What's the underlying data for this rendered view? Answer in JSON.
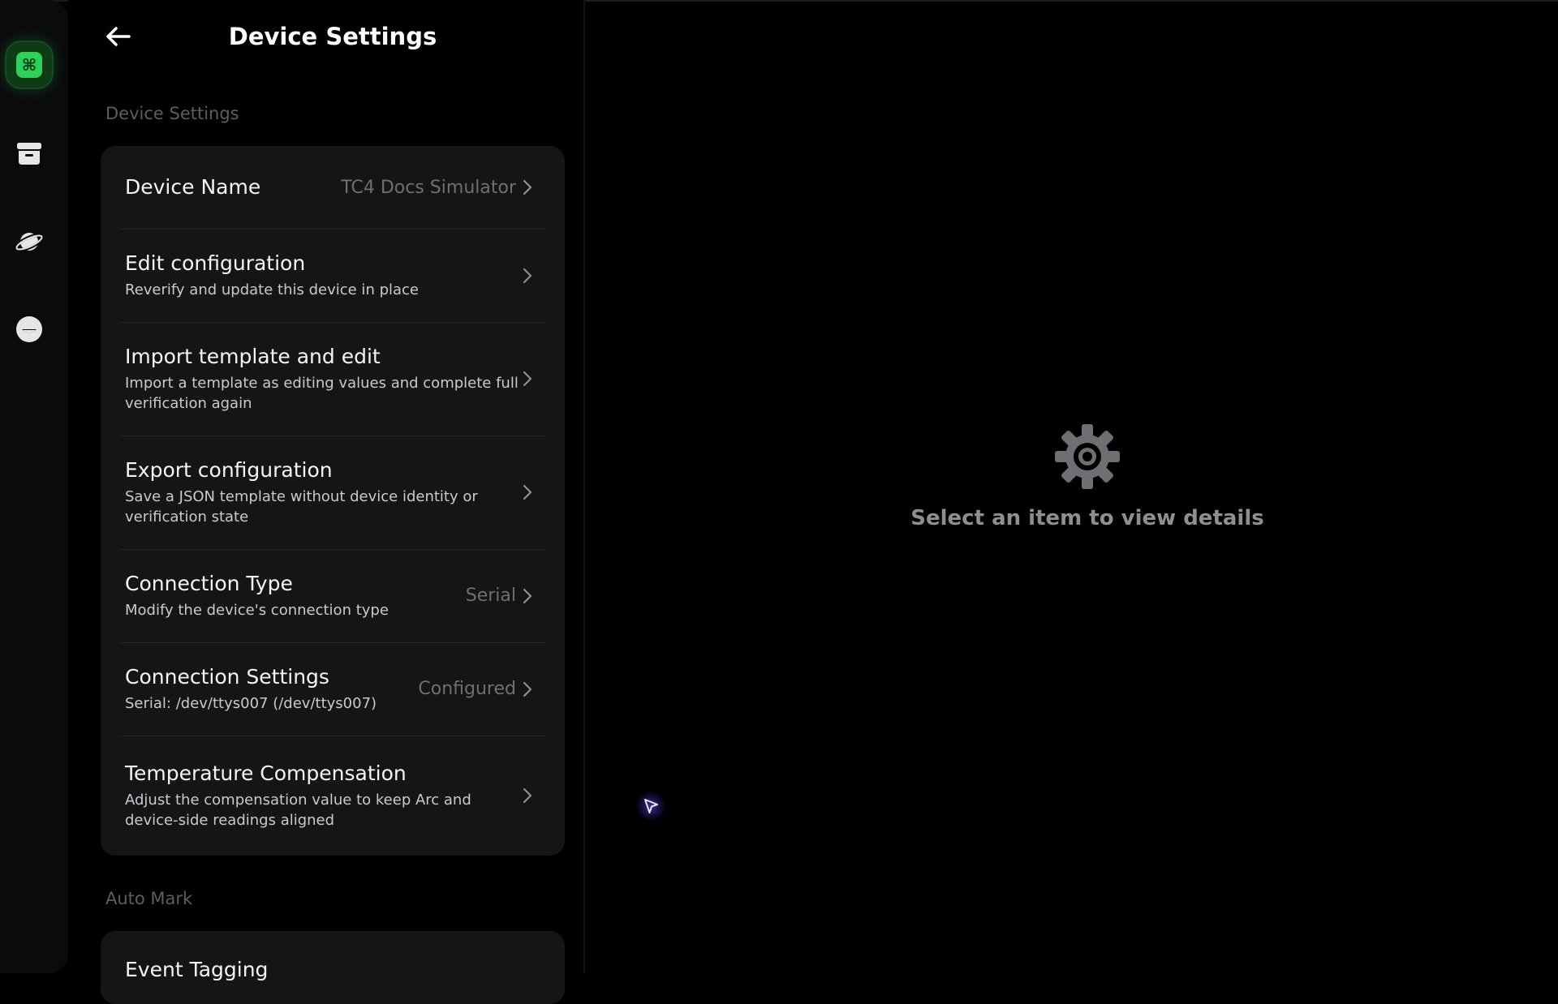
{
  "rail": {
    "items": [
      {
        "icon": "command-app-icon",
        "active": true
      },
      {
        "icon": "archive-icon",
        "active": false
      },
      {
        "icon": "planet-icon",
        "active": false
      },
      {
        "icon": "smiley-icon",
        "active": false
      }
    ]
  },
  "header": {
    "title": "Device Settings"
  },
  "sections": {
    "device_settings_label": "Device Settings",
    "auto_mark_label": "Auto Mark"
  },
  "rows": [
    {
      "title": "Device Name",
      "subtitle": "",
      "value": "TC4 Docs Simulator"
    },
    {
      "title": "Edit configuration",
      "subtitle": "Reverify and update this device in place",
      "value": ""
    },
    {
      "title": "Import template and edit",
      "subtitle": "Import a template as editing values and complete full verification again",
      "value": ""
    },
    {
      "title": "Export configuration",
      "subtitle": "Save a JSON template without device identity or verification state",
      "value": ""
    },
    {
      "title": "Connection Type",
      "subtitle": "Modify the device's connection type",
      "value": "Serial"
    },
    {
      "title": "Connection Settings",
      "subtitle": "Serial: /dev/ttys007 (/dev/ttys007)",
      "value": "Configured"
    },
    {
      "title": "Temperature Compensation",
      "subtitle": "Adjust the compensation value to keep Arc and device-side readings aligned",
      "value": ""
    }
  ],
  "auto_mark_rows": [
    {
      "title": "Event Tagging"
    }
  ],
  "detail": {
    "empty_text": "Select an item to view details"
  },
  "colors": {
    "accent": "#2ed158",
    "card_bg": "#151517",
    "muted_text": "#6e6e73"
  }
}
